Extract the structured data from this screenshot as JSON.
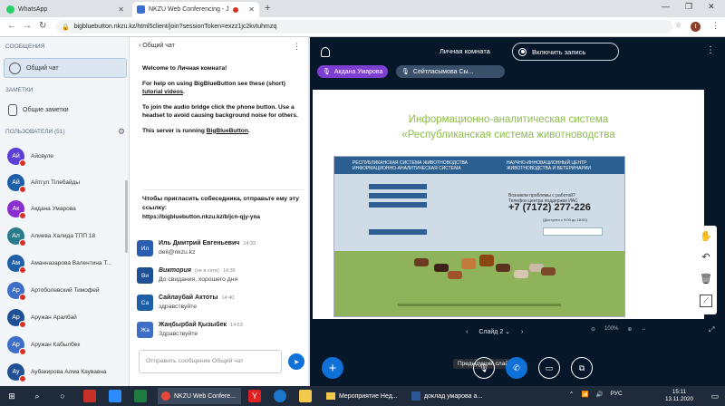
{
  "browser": {
    "tabs": [
      {
        "title": "WhatsApp",
        "active": false
      },
      {
        "title": "NKZU Web Conferencing - J",
        "active": true
      }
    ],
    "url": "bigbluebutton.nkzu.kz/html5client/join?sessionToken=exzz1jc2kvtuhmzq",
    "profile_initial": "t"
  },
  "sidebar": {
    "messages_title": "СООБЩЕНИЯ",
    "public_chat": "Общий чат",
    "notes_title": "ЗАМЕТКИ",
    "shared_notes": "Общие заметки",
    "users_title": "ПОЛЬЗОВАТЕЛИ (51)",
    "users": [
      {
        "initials": "Ай",
        "name": "Айсвуле",
        "color": "#5b3fd6"
      },
      {
        "initials": "Ай",
        "name": "Айтгул Тілебайды",
        "color": "#1f5fa8"
      },
      {
        "initials": "Ак",
        "name": "Акдана Умарова",
        "color": "#8a2ecf"
      },
      {
        "initials": "Ал",
        "name": "Алиева Халида ТПП 18",
        "color": "#2a7b8c"
      },
      {
        "initials": "Ам",
        "name": "Аманназарова Валентина Т...",
        "color": "#1f5fa8"
      },
      {
        "initials": "Ар",
        "name": "Артоболевский Тимофей",
        "color": "#3d6fc9"
      },
      {
        "initials": "Ар",
        "name": "Аружан Аралбай",
        "color": "#1f4f94"
      },
      {
        "initials": "Ар",
        "name": "Аружан Кабылбек",
        "color": "#3d6fc9"
      },
      {
        "initials": "Ау",
        "name": "Аубакирова Алма Каувавна",
        "color": "#1f4f94"
      }
    ]
  },
  "chat": {
    "header": "Общий чат",
    "welcome_prefix": "Welcome to ",
    "welcome_room": "Личная комната",
    "welcome_suffix": "!",
    "help_prefix": "For help on using BigBlueButton see these (short) ",
    "help_link": "tutorial videos",
    "help_suffix": ".",
    "audio_text": "To join the audio bridge click the phone button. Use a headset to avoid causing background noise for others.",
    "server_prefix": "This server is running ",
    "server_link": "BigBlueButton",
    "server_suffix": ".",
    "invite_text": "Чтобы пригласить собеседника, отправьте ему эту ссылку:",
    "invite_link": "https://bigbluebutton.nkzu.kz/b/jcn-qjy-yna",
    "messages": [
      {
        "initials": "Ил",
        "name": "Иль Дмитрий Евгеньевич",
        "time": "14:33",
        "status": "",
        "text": "deil@nkzu.kz",
        "color": "#2a5db0"
      },
      {
        "initials": "Ви",
        "name": "Виктория",
        "time": "14:36",
        "status": "(не в сети)",
        "text": "До свидания, хорошего дня",
        "color": "#1f4f94"
      },
      {
        "initials": "Са",
        "name": "Сайлаубай Актоты",
        "time": "14:40",
        "status": "",
        "text": "здравствуйте",
        "color": "#1f5fa8"
      },
      {
        "initials": "Жа",
        "name": "Жаңбырбай Қызыбек",
        "time": "14:53",
        "status": "",
        "text": "Здравствуйте",
        "color": "#3d6fc9"
      }
    ],
    "input_placeholder": "Отправить сообщение Общий чат"
  },
  "presentation": {
    "room_title": "Личная комната",
    "record_label": "Включить запись",
    "talkers": [
      "Акдана Умарова",
      "Сейтласымова Сы..."
    ],
    "slide_title_1": "Информационно-аналитическая система",
    "slide_title_2": "«Республиканская система животноводства",
    "site_header_left": "РЕСПУБЛИКАНСКАЯ СИСТЕМА ЖИВОТНОВОДСТВА ИНФОРМАЦИОННО-АНАЛИТИЧЕСКАЯ СИСТЕМА",
    "site_header_right": "НАУЧНО-ИННОВАЦИОННЫЙ ЦЕНТР ЖИВОТНОВОДСТВА И ВЕТЕРИНАРИИ",
    "site_question": "Возникли проблемы с работой?",
    "site_support": "Телефон центра поддержки ИАС",
    "site_phone": "+7 (7172) 277-226",
    "site_hours": "(Доступен с 9:00 до 18:00)",
    "prev_tooltip": "Предыдущий слайд",
    "slide_label": "Слайд 2",
    "zoom": "100%"
  },
  "taskbar": {
    "apps": [
      "NKZU Web Confere...",
      "Мероприятие Нед...",
      "доклад умарова а..."
    ],
    "lang": "РУС",
    "time": "15:11",
    "date": "13.11.2020"
  }
}
